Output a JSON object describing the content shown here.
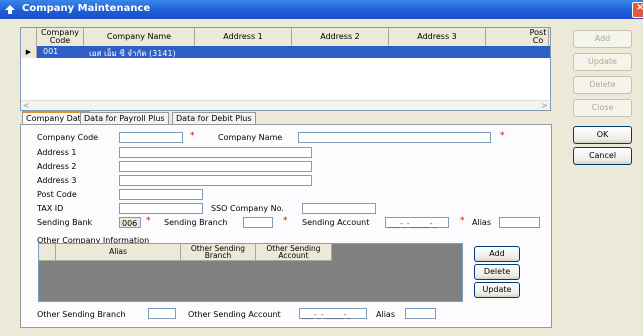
{
  "window": {
    "title": "Company Maintenance",
    "close_glyph": "×"
  },
  "grid": {
    "headers": [
      "Company Code",
      "Company Name",
      "Address 1",
      "Address 2",
      "Address 3",
      "Post Co"
    ],
    "row": {
      "indicator": "▶",
      "code": "001",
      "name": "เอส เอ็ม ซี จำกัด (3141)"
    }
  },
  "side_buttons": {
    "add": "Add",
    "update": "Update",
    "delete": "Delete",
    "close": "Close",
    "ok": "OK",
    "cancel": "Cancel"
  },
  "tabs": [
    "Company Data",
    "Data for Payroll Plus",
    "Data for Debit Plus"
  ],
  "form": {
    "company_code_label": "Company Code",
    "company_name_label": "Company Name",
    "address1_label": "Address 1",
    "address2_label": "Address 2",
    "address3_label": "Address 3",
    "post_code_label": "Post Code",
    "tax_id_label": "TAX ID",
    "sso_label": "SSO Company No.",
    "sending_bank_label": "Sending Bank",
    "sending_bank_value": "006",
    "sending_branch_label": "Sending Branch",
    "sending_account_label": "Sending Account",
    "sending_account_mask": "___-_-_____-_",
    "alias_label": "Alias",
    "required_mark": "*"
  },
  "other_info": {
    "section_label": "Other Company Information",
    "headers": [
      "Alias",
      "Other Sending Branch",
      "Other Sending Account"
    ],
    "add": "Add",
    "delete": "Delete",
    "update": "Update",
    "branch_label": "Other Sending Branch",
    "account_label": "Other Sending Account",
    "account_mask": "___-_-_____-_",
    "alias_label": "Alias"
  },
  "colors": {
    "title_bar": "#1c5cd6",
    "selection": "#2f5fc6",
    "required": "#dd0000"
  }
}
